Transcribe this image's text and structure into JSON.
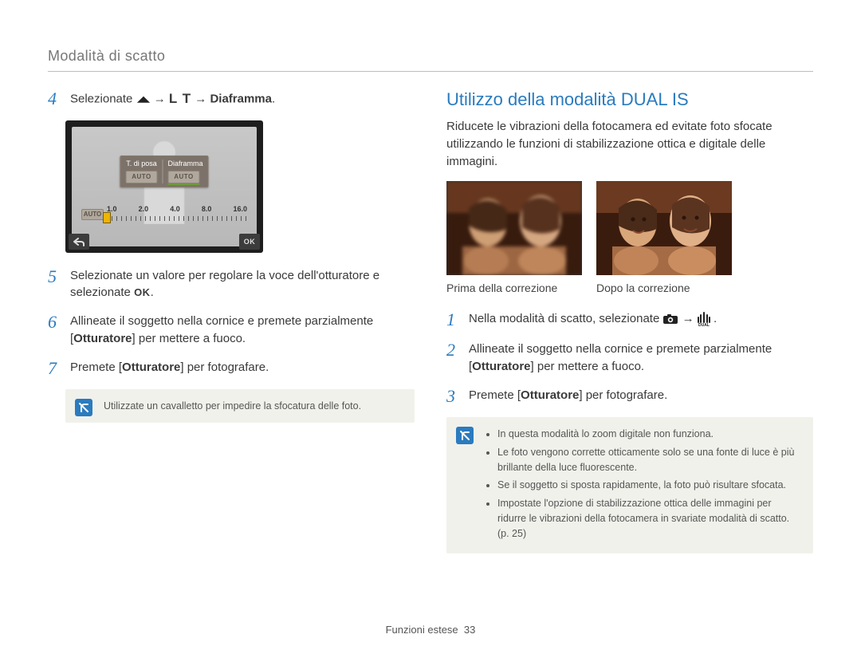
{
  "section_title": "Modalità di scatto",
  "left": {
    "steps": {
      "4": {
        "num": "4",
        "pre": "Selezionate ",
        "post": " → ",
        "tail": " → ",
        "bold": "Diaframma",
        "end": "."
      },
      "5": {
        "num": "5",
        "text_a": "Selezionate un valore per regolare la voce dell'otturatore e selezionate ",
        "ok": "OK",
        "end": "."
      },
      "6": {
        "num": "6",
        "text_a": "Allineate il soggetto nella cornice e premete parzialmente [",
        "bold": "Otturatore",
        "text_b": "] per mettere a fuoco."
      },
      "7": {
        "num": "7",
        "text_a": "Premete [",
        "bold": "Otturatore",
        "text_b": "] per fotografare."
      }
    },
    "lcd": {
      "tab_left": "T. di posa",
      "tab_right": "Diaframma",
      "auto_a": "AUTO",
      "auto_b": "AUTO",
      "scale_auto": "AUTO",
      "scale_labels": [
        "1.0",
        "2.0",
        "4.0",
        "8.0",
        "16.0"
      ],
      "ok": "OK"
    },
    "note": "Utilizzate un cavalletto per impedire la sfocatura delle foto."
  },
  "right": {
    "heading": "Utilizzo della modalità DUAL IS",
    "intro": "Riducete le vibrazioni della fotocamera ed evitate foto sfocate utilizzando le funzioni di stabilizzazione ottica e digitale delle immagini.",
    "caption_before": "Prima della correzione",
    "caption_after": "Dopo la correzione",
    "steps": {
      "1": {
        "num": "1",
        "text_a": "Nella modalità di scatto, selezionate ",
        "arrow": " → ",
        "end": "."
      },
      "2": {
        "num": "2",
        "text_a": "Allineate il soggetto nella cornice e premete parzialmente [",
        "bold": "Otturatore",
        "text_b": "] per mettere a fuoco."
      },
      "3": {
        "num": "3",
        "text_a": "Premete [",
        "bold": "Otturatore",
        "text_b": "] per fotografare."
      }
    },
    "notes": [
      "In questa modalità lo zoom digitale non funziona.",
      "Le foto vengono corrette otticamente solo se una fonte di luce è più brillante della luce fluorescente.",
      "Se il soggetto si sposta rapidamente, la foto può risultare sfocata.",
      "Impostate l'opzione di stabilizzazione ottica delle immagini per ridurre le vibrazioni della fotocamera in svariate modalità di scatto. (p. 25)"
    ]
  },
  "footer": {
    "label": "Funzioni estese",
    "page": "33"
  }
}
